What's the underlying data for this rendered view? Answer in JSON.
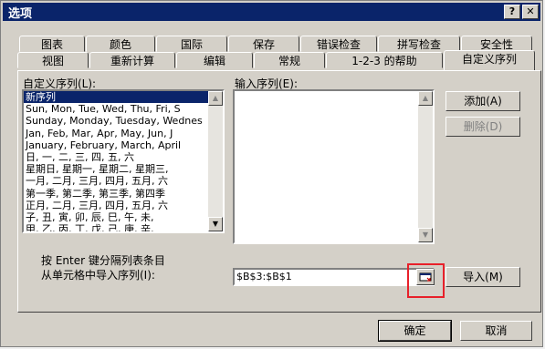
{
  "window": {
    "title": "选项",
    "help_label": "?",
    "close_label": "✕"
  },
  "tabs_row1": [
    "图表",
    "颜色",
    "国际",
    "保存",
    "错误检查",
    "拼写检查",
    "安全性"
  ],
  "tabs_row2": [
    "视图",
    "重新计算",
    "编辑",
    "常规",
    "1-2-3 的帮助",
    "自定义序列"
  ],
  "custom_lists": {
    "label": "自定义序列(L):",
    "items": [
      "新序列",
      "Sun, Mon, Tue, Wed, Thu, Fri, S",
      "Sunday, Monday, Tuesday, Wednes",
      "Jan, Feb, Mar, Apr, May, Jun, J",
      "January, February, March, April",
      "日, 一, 二, 三, 四, 五, 六",
      "星期日, 星期一, 星期二, 星期三,",
      "一月, 二月, 三月, 四月, 五月, 六",
      "第一季, 第二季, 第三季, 第四季",
      "正月, 二月, 三月, 四月, 五月, 六",
      "子, 丑, 寅, 卯, 辰, 巳, 午, 未,",
      "甲, 乙, 丙, 丁, 戊, 己, 庚, 辛,"
    ],
    "selected_index": 0
  },
  "entries": {
    "label": "输入序列(E):",
    "value": ""
  },
  "buttons": {
    "add": "添加(A)",
    "delete": "删除(D)",
    "import": "导入(M)",
    "ok": "确定",
    "cancel": "取消"
  },
  "hint": "按 Enter 键分隔列表条目",
  "import_row": {
    "label": "从单元格中导入序列(I):",
    "value": "$B$3:$B$1"
  },
  "icons": {
    "scroll_up": "▲",
    "scroll_down": "▼",
    "collapse_dialog": "range-select-icon"
  },
  "highlight_color": "#e8202a"
}
